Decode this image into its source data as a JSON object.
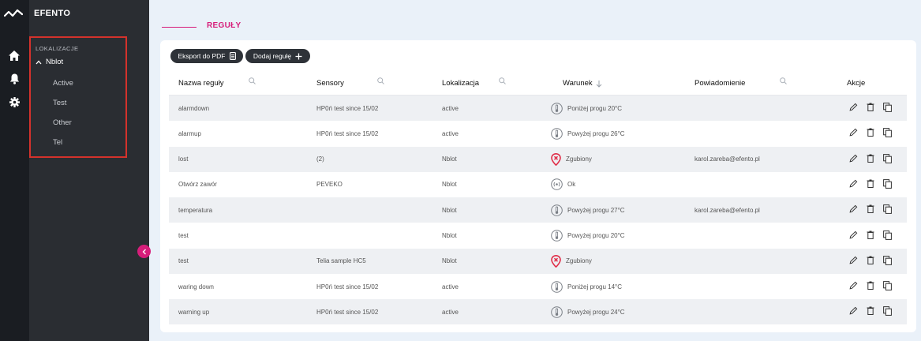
{
  "app": {
    "brand": "EFENTO"
  },
  "sidebar": {
    "section_title": "LOKALIZACJE",
    "root": "Nblot",
    "items": [
      {
        "label": "Active"
      },
      {
        "label": "Test"
      },
      {
        "label": "Other"
      },
      {
        "label": "Tel"
      }
    ]
  },
  "page": {
    "title": "REGUŁY"
  },
  "toolbar": {
    "export_label": "Eksport do PDF",
    "add_label": "Dodaj regułę"
  },
  "table": {
    "headers": {
      "name": "Nazwa reguły",
      "sensors": "Sensory",
      "location": "Lokalizacja",
      "condition": "Warunek",
      "notification": "Powiadomienie",
      "actions": "Akcje"
    },
    "rows": [
      {
        "name": "alarmdown",
        "sensors": "HP0ń test since 15/02",
        "location": "active",
        "condition": "Poniżej progu 20°C",
        "condition_icon": "thermometer-icon",
        "notification": ""
      },
      {
        "name": "alarmup",
        "sensors": "HP0ń test since 15/02",
        "location": "active",
        "condition": "Powyżej progu 26°C",
        "condition_icon": "thermometer-icon",
        "notification": ""
      },
      {
        "name": "lost",
        "sensors": "(2)",
        "location": "Nblot",
        "condition": "Zgubiony",
        "condition_icon": "lost-pin-icon",
        "notification": "karol.zareba@efento.pl"
      },
      {
        "name": "Otwórz zawór",
        "sensors": "PEVEKO",
        "location": "Nblot",
        "condition": "Ok",
        "condition_icon": "ok-signal-icon",
        "notification": ""
      },
      {
        "name": "temperatura",
        "sensors": "",
        "location": "Nblot",
        "condition": "Powyżej progu 27°C",
        "condition_icon": "thermometer-icon",
        "notification": "karol.zareba@efento.pl"
      },
      {
        "name": "test",
        "sensors": "",
        "location": "Nblot",
        "condition": "Powyżej progu 20°C",
        "condition_icon": "thermometer-icon",
        "notification": ""
      },
      {
        "name": "test",
        "sensors": "Telia sample HC5",
        "location": "Nblot",
        "condition": "Zgubiony",
        "condition_icon": "lost-pin-icon",
        "notification": ""
      },
      {
        "name": "waring down",
        "sensors": "HP0ń test since 15/02",
        "location": "active",
        "condition": "Poniżej progu 14°C",
        "condition_icon": "thermometer-icon",
        "notification": ""
      },
      {
        "name": "warning up",
        "sensors": "HP0ń test since 15/02",
        "location": "active",
        "condition": "Powyżej progu 24°C",
        "condition_icon": "thermometer-icon",
        "notification": ""
      }
    ]
  },
  "colors": {
    "accent": "#d61d7a",
    "highlight_box": "#d4322c",
    "lost": "#e0304a"
  }
}
